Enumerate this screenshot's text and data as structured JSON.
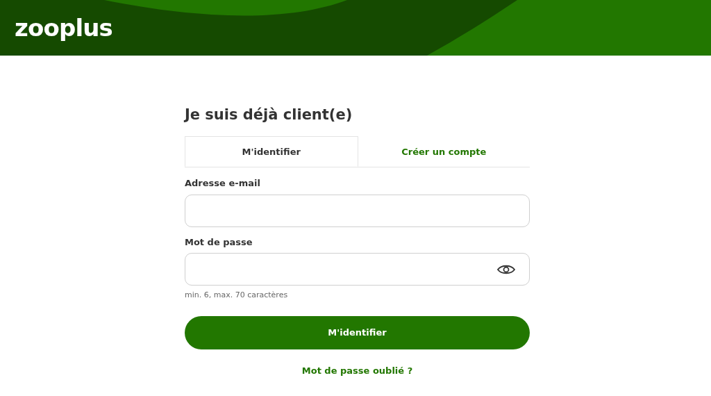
{
  "header": {
    "logo": "zooplus"
  },
  "login": {
    "title": "Je suis déjà client(e)",
    "tabs": [
      {
        "label": "M'identifier",
        "selected": true
      },
      {
        "label": "Créer un compte",
        "selected": false
      }
    ],
    "email": {
      "label": "Adresse e-mail"
    },
    "password": {
      "label": "Mot de passe",
      "hint": "min. 6, max. 70 caractères"
    },
    "submit": "M'identifier",
    "forgot_link": "Mot de passe oublié ?"
  }
}
